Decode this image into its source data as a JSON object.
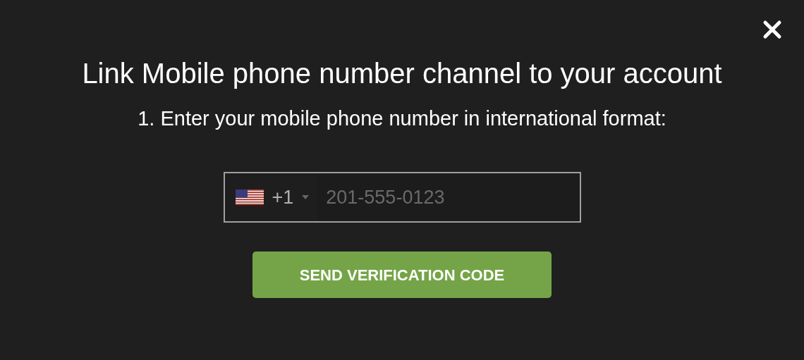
{
  "dialog": {
    "title": "Link Mobile phone number channel to your account",
    "instruction": "1. Enter your mobile phone number in international format:"
  },
  "phone_field": {
    "dial_code": "+1",
    "placeholder": "201-555-0123"
  },
  "buttons": [
    "SEND VERIFICATION CODE"
  ]
}
